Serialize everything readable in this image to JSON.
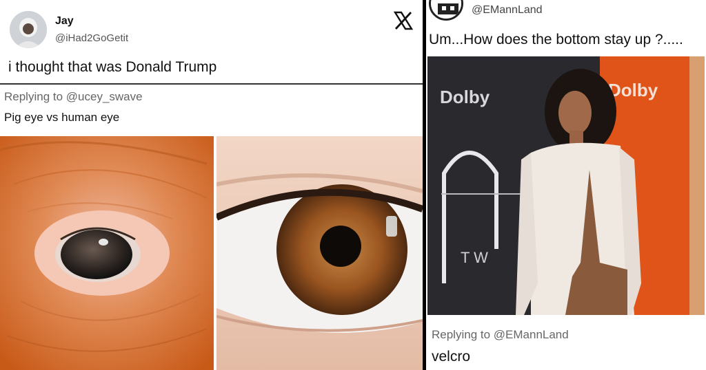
{
  "left_tweet": {
    "author_name": "Jay",
    "author_handle": "@iHad2GoGetit",
    "text": "i thought that was Donald Trump",
    "reply_prefix": "Replying to ",
    "reply_mention": "@ucey_swave",
    "quoted_text": "Pig eye vs human eye",
    "logo_icon": "x-logo-icon",
    "images": [
      "pig-eye-photo",
      "human-eye-photo"
    ]
  },
  "right_tweet": {
    "author_handle": "@EMannLand",
    "text": "Um...How does the bottom stay up ?.....",
    "reply_prefix": "Replying to ",
    "reply_mention": "@EMannLand",
    "reply_text": "velcro",
    "photo": "red-carpet-photo",
    "backdrop_text": [
      "Dolby",
      "Dolby",
      "T W"
    ]
  },
  "colors": {
    "pig_skin": "#d96a2a",
    "iris_brown": "#8a4a1a",
    "backdrop_orange": "#e0541a",
    "backdrop_dark": "#2a2a2e",
    "dress_white": "#efe9e2"
  }
}
